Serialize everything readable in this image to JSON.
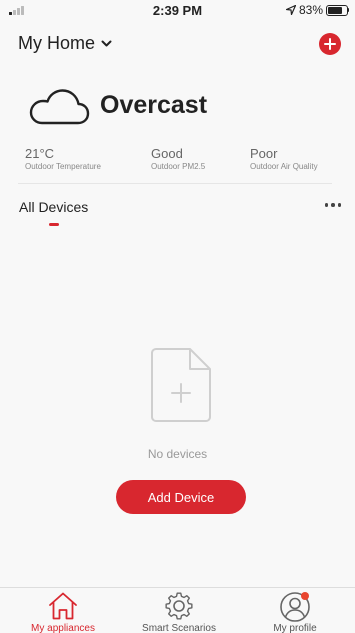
{
  "status_bar": {
    "time": "2:39 PM",
    "battery": "83%"
  },
  "header": {
    "title": "My Home"
  },
  "weather": {
    "condition": "Overcast",
    "stats": [
      {
        "value": "21°C",
        "label": "Outdoor Temperature"
      },
      {
        "value": "Good",
        "label": "Outdoor PM2.5"
      },
      {
        "value": "Poor",
        "label": "Outdoor Air Quality"
      }
    ]
  },
  "devices": {
    "tab_label": "All Devices",
    "empty_text": "No devices",
    "add_button_label": "Add Device"
  },
  "bottom_nav": {
    "items": [
      {
        "label": "My appliances",
        "icon": "home-icon",
        "active": true
      },
      {
        "label": "Smart Scenarios",
        "icon": "gear-icon",
        "active": false
      },
      {
        "label": "My profile",
        "icon": "profile-icon",
        "active": false
      }
    ]
  },
  "colors": {
    "accent": "#d8272f",
    "background": "#f8f8f8"
  }
}
